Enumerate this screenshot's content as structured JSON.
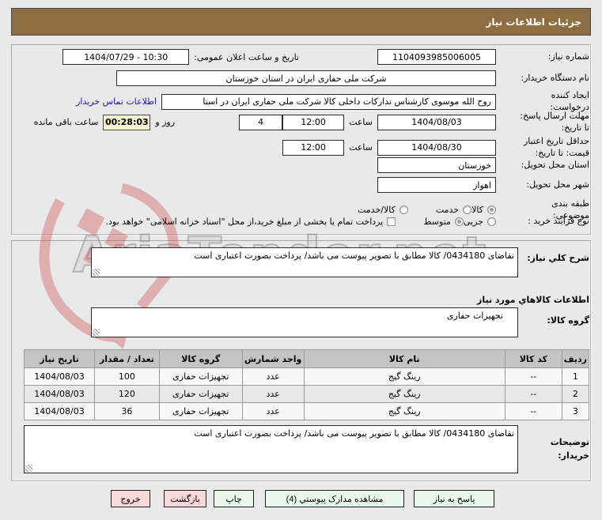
{
  "header": {
    "title": "جزئیات اطلاعات نیاز"
  },
  "watermark": {
    "text": "AriaTender.net"
  },
  "form": {
    "need_number": {
      "label": "شماره نیاز:",
      "value": "1104093985006005"
    },
    "announce_datetime": {
      "label": "تاریخ و ساعت اعلان عمومی:",
      "value": "1404/07/29 - 10:30"
    },
    "buyer_org": {
      "label": "نام دستگاه خریدار:",
      "value": "شرکت ملی حفاری ایران در استان خوزستان"
    },
    "request_creator": {
      "label": "ایجاد کننده درخواست:",
      "value": "روح الله موسوی کارشناس تدارکات داخلی کالا شرکت ملی حفاری ایران در استا",
      "contact_link": "اطلاعات تماس خریدار"
    },
    "reply_deadline": {
      "label": "مهلت ارسال پاسخ: تا تاریخ:",
      "date": "1404/08/03",
      "hour_label": "ساعت",
      "time": "12:00",
      "days_value": "4",
      "days_label": "روز و",
      "remaining_time": "00:28:03",
      "remaining_label": "ساعت باقی مانده"
    },
    "price_validity": {
      "label": "حداقل تاریخ اعتبار قیمت: تا تاریخ:",
      "date": "1404/08/30",
      "hour_label": "ساعت",
      "time": "12:00"
    },
    "delivery_province": {
      "label": "استان محل تحویل:",
      "value": "خوزستان"
    },
    "delivery_city": {
      "label": "شهر محل تحویل:",
      "value": "اهواز"
    },
    "subject_classification": {
      "label": "طبقه بندی موضوعی:",
      "options": [
        {
          "label": "کالا",
          "selected": true
        },
        {
          "label": "خدمت",
          "selected": false
        },
        {
          "label": "کالا/خدمت",
          "selected": false
        }
      ]
    },
    "purchase_process": {
      "label": "نوع فرآیند خرید :",
      "options": [
        {
          "label": "جزیی",
          "selected": false
        },
        {
          "label": "متوسط",
          "selected": true
        }
      ],
      "checkbox_label": "پرداخت تمام یا بخشی از مبلغ خرید،از محل \"اسناد خزانه اسلامی\" خواهد بود.",
      "checkbox_checked": false
    }
  },
  "need_description": {
    "label": "شرح کلي نیاز:",
    "value": "تقاضای 0434180/ کالا مطابق با تصویر پیوست می باشد/ پرداخت بصورت اعتباری است"
  },
  "goods_section": {
    "heading": "اطلاعات کالاهاي مورد نیاز",
    "goods_group": {
      "label": "گروه کالا:",
      "value": "تجهیزات حفاری"
    },
    "table": {
      "headers": [
        "ردیف",
        "کد کالا",
        "نام کالا",
        "واحد شمارش",
        "گروه کالا",
        "تعداد / مقدار",
        "تاریخ نیاز"
      ],
      "rows": [
        [
          "1",
          "--",
          "رینگ گیج",
          "عدد",
          "تجهیزات حفاری",
          "100",
          "1404/08/03"
        ],
        [
          "2",
          "--",
          "رینگ گیج",
          "عدد",
          "تجهیزات حفاری",
          "120",
          "1404/08/03"
        ],
        [
          "3",
          "--",
          "رینگ گیج",
          "عدد",
          "تجهیزات حفاری",
          "36",
          "1404/08/03"
        ]
      ]
    }
  },
  "buyer_notes": {
    "label": "توضیحات خریدار:",
    "value": "تقاضای 0434180/ کالا مطابق با تصویر پیوست می باشد/ پرداخت بصورت اعتباری است"
  },
  "buttons": {
    "reply": "پاسخ به نیاز",
    "view_docs": "مشاهده مدارک پیوستي (4)",
    "print": "چاپ",
    "back": "بازگشت",
    "exit": "خروج"
  },
  "colors": {
    "titlebar": "#8d6e42",
    "highlight_time_bg": "#f6f2cf",
    "button_green": "#e9f8ec",
    "button_pink": "#f9d9d9",
    "table_header_bg": "#c4c4c4",
    "link_blue": "#1414cc"
  }
}
